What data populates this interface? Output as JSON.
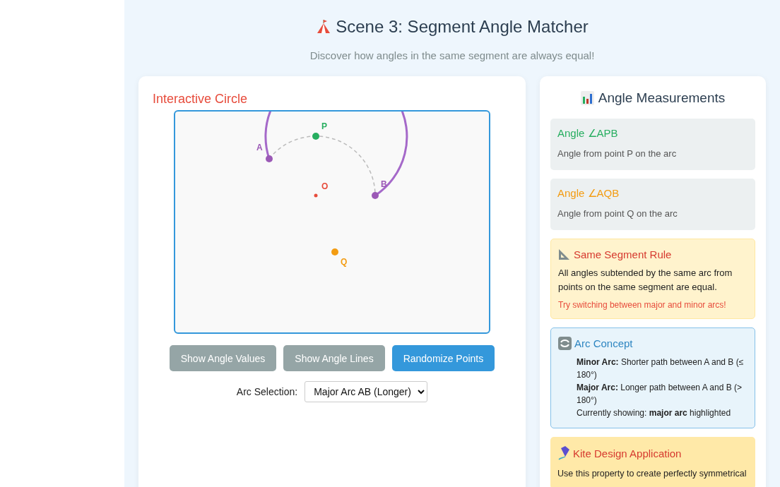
{
  "header": {
    "title": "Scene 3: Segment Angle Matcher",
    "subtitle": "Discover how angles in the same segment are always equal!"
  },
  "circle_panel": {
    "title": "Interactive Circle",
    "points": [
      {
        "label": "A",
        "color": "#9b59b6",
        "kind": "endpoint"
      },
      {
        "label": "P",
        "color": "#27ae60",
        "kind": "point"
      },
      {
        "label": "O",
        "color": "#e74c3c",
        "kind": "center"
      },
      {
        "label": "B",
        "color": "#9b59b6",
        "kind": "endpoint"
      },
      {
        "label": "Q",
        "color": "#f39c12",
        "kind": "point"
      }
    ],
    "buttons": [
      {
        "label": "Show Angle Values",
        "kind": "secondary"
      },
      {
        "label": "Show Angle Lines",
        "kind": "secondary"
      },
      {
        "label": "Randomize Points",
        "kind": "primary"
      }
    ],
    "arc_selection": {
      "label": "Arc Selection:",
      "value": "Major Arc AB (Longer)"
    }
  },
  "measurements_panel": {
    "title": "Angle Measurements",
    "cards": [
      {
        "kind": "angle",
        "title": "Angle ∠APB",
        "text": "Angle from point P on the arc",
        "color": "#27ae60"
      },
      {
        "kind": "angle",
        "title": "Angle ∠AQB",
        "text": "Angle from point Q on the arc",
        "color": "#f39c12"
      },
      {
        "kind": "rule",
        "title": "Same Segment Rule",
        "text": "All angles subtended by the same arc from points on the same segment are equal.",
        "hint": "Try switching between major and minor arcs!"
      },
      {
        "kind": "concept",
        "title": "Arc Concept",
        "lines": [
          "**Minor Arc:** Shorter path between A and B (≤ 180°)",
          "**Major Arc:** Longer path between A and B (> 180°)",
          "Currently showing: **major arc** highlighted"
        ]
      },
      {
        "kind": "application",
        "title": "Kite Design Application",
        "text": "Use this property to create perfectly symmetrical"
      }
    ]
  }
}
